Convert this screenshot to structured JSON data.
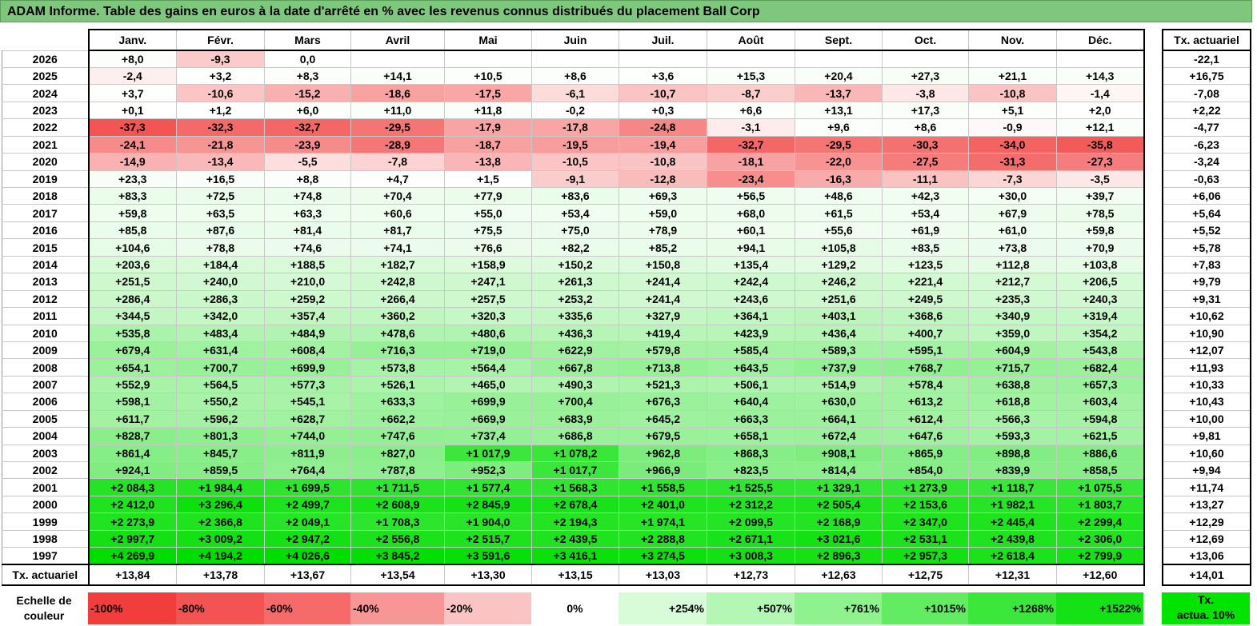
{
  "title": "ADAM Informe. Table des gains en euros à la date d'arrêté en % avec les revenus connus distribués du placement Ball Corp",
  "months": [
    "Janv.",
    "Févr.",
    "Mars",
    "Avril",
    "Mai",
    "Juin",
    "Juil.",
    "Août",
    "Sept.",
    "Oct.",
    "Nov.",
    "Déc."
  ],
  "side_header": "Tx. actuariel",
  "rows": [
    {
      "year": "2026",
      "values": [
        "+8,0",
        "-9,3",
        "0,0",
        "",
        "",
        "",
        "",
        "",
        "",
        "",
        "",
        ""
      ],
      "tx": "-22,1"
    },
    {
      "year": "2025",
      "values": [
        "-2,4",
        "+3,2",
        "+8,3",
        "+14,1",
        "+10,5",
        "+8,6",
        "+3,6",
        "+15,3",
        "+20,4",
        "+27,3",
        "+21,1",
        "+14,3"
      ],
      "tx": "+16,75"
    },
    {
      "year": "2024",
      "values": [
        "+3,7",
        "-10,6",
        "-15,2",
        "-18,6",
        "-17,5",
        "-6,1",
        "-10,7",
        "-8,7",
        "-13,7",
        "-3,8",
        "-10,8",
        "-1,4"
      ],
      "tx": "-7,08"
    },
    {
      "year": "2023",
      "values": [
        "+0,1",
        "+1,2",
        "+6,0",
        "+11,0",
        "+11,8",
        "-0,2",
        "+0,3",
        "+6,6",
        "+13,1",
        "+17,3",
        "+5,1",
        "+2,0"
      ],
      "tx": "+2,22"
    },
    {
      "year": "2022",
      "values": [
        "-37,3",
        "-32,3",
        "-32,7",
        "-29,5",
        "-17,9",
        "-17,8",
        "-24,8",
        "-3,1",
        "+9,6",
        "+8,6",
        "-0,9",
        "+12,1"
      ],
      "tx": "-4,77"
    },
    {
      "year": "2021",
      "values": [
        "-24,1",
        "-21,8",
        "-23,9",
        "-28,9",
        "-18,7",
        "-19,5",
        "-19,4",
        "-32,7",
        "-29,5",
        "-30,3",
        "-34,0",
        "-35,8"
      ],
      "tx": "-6,23"
    },
    {
      "year": "2020",
      "values": [
        "-14,9",
        "-13,4",
        "-5,5",
        "-7,8",
        "-13,8",
        "-10,5",
        "-10,8",
        "-18,1",
        "-22,0",
        "-27,5",
        "-31,3",
        "-27,3"
      ],
      "tx": "-3,24"
    },
    {
      "year": "2019",
      "values": [
        "+23,3",
        "+16,5",
        "+8,8",
        "+4,7",
        "+1,5",
        "-9,1",
        "-12,8",
        "-23,4",
        "-16,3",
        "-11,1",
        "-7,3",
        "-3,5"
      ],
      "tx": "-0,63"
    },
    {
      "year": "2018",
      "values": [
        "+83,3",
        "+72,5",
        "+74,8",
        "+70,4",
        "+77,9",
        "+83,6",
        "+69,3",
        "+56,5",
        "+48,6",
        "+42,3",
        "+30,0",
        "+39,7"
      ],
      "tx": "+6,06"
    },
    {
      "year": "2017",
      "values": [
        "+59,8",
        "+63,5",
        "+63,3",
        "+60,6",
        "+55,0",
        "+53,4",
        "+59,0",
        "+68,0",
        "+61,5",
        "+53,4",
        "+67,9",
        "+78,5"
      ],
      "tx": "+5,64"
    },
    {
      "year": "2016",
      "values": [
        "+85,8",
        "+87,6",
        "+81,4",
        "+81,7",
        "+75,5",
        "+75,0",
        "+78,9",
        "+60,1",
        "+55,6",
        "+61,9",
        "+61,0",
        "+59,8"
      ],
      "tx": "+5,52"
    },
    {
      "year": "2015",
      "values": [
        "+104,6",
        "+78,8",
        "+74,6",
        "+74,1",
        "+76,6",
        "+82,2",
        "+85,2",
        "+94,1",
        "+105,8",
        "+83,5",
        "+73,8",
        "+70,9"
      ],
      "tx": "+5,78"
    },
    {
      "year": "2014",
      "values": [
        "+203,6",
        "+184,4",
        "+188,5",
        "+182,7",
        "+158,9",
        "+150,2",
        "+150,8",
        "+135,4",
        "+129,2",
        "+123,5",
        "+112,8",
        "+103,8"
      ],
      "tx": "+7,83"
    },
    {
      "year": "2013",
      "values": [
        "+251,5",
        "+240,0",
        "+210,0",
        "+242,8",
        "+247,1",
        "+261,3",
        "+241,4",
        "+242,4",
        "+246,2",
        "+221,4",
        "+212,7",
        "+206,5"
      ],
      "tx": "+9,79"
    },
    {
      "year": "2012",
      "values": [
        "+286,4",
        "+286,3",
        "+259,2",
        "+266,4",
        "+257,5",
        "+253,2",
        "+241,4",
        "+243,6",
        "+251,6",
        "+249,5",
        "+235,3",
        "+240,3"
      ],
      "tx": "+9,31"
    },
    {
      "year": "2011",
      "values": [
        "+344,5",
        "+342,0",
        "+357,4",
        "+360,2",
        "+320,3",
        "+335,6",
        "+327,9",
        "+364,1",
        "+403,1",
        "+368,6",
        "+340,9",
        "+319,4"
      ],
      "tx": "+10,62"
    },
    {
      "year": "2010",
      "values": [
        "+535,8",
        "+483,4",
        "+484,9",
        "+478,6",
        "+480,6",
        "+436,3",
        "+419,4",
        "+423,9",
        "+436,4",
        "+400,7",
        "+359,0",
        "+354,2"
      ],
      "tx": "+10,90"
    },
    {
      "year": "2009",
      "values": [
        "+679,4",
        "+631,4",
        "+608,4",
        "+716,3",
        "+719,0",
        "+622,9",
        "+579,8",
        "+585,4",
        "+589,3",
        "+595,1",
        "+604,9",
        "+543,8"
      ],
      "tx": "+12,07"
    },
    {
      "year": "2008",
      "values": [
        "+654,1",
        "+700,7",
        "+699,9",
        "+573,8",
        "+564,4",
        "+667,8",
        "+713,8",
        "+643,5",
        "+737,9",
        "+768,7",
        "+715,7",
        "+682,4"
      ],
      "tx": "+11,93"
    },
    {
      "year": "2007",
      "values": [
        "+552,9",
        "+564,5",
        "+577,3",
        "+526,1",
        "+465,0",
        "+490,3",
        "+521,3",
        "+506,1",
        "+514,9",
        "+578,4",
        "+638,8",
        "+657,3"
      ],
      "tx": "+10,33"
    },
    {
      "year": "2006",
      "values": [
        "+598,1",
        "+550,2",
        "+545,1",
        "+633,3",
        "+699,9",
        "+700,4",
        "+676,3",
        "+640,4",
        "+630,0",
        "+613,2",
        "+618,8",
        "+603,4"
      ],
      "tx": "+10,43"
    },
    {
      "year": "2005",
      "values": [
        "+611,7",
        "+596,2",
        "+628,7",
        "+662,2",
        "+669,9",
        "+683,9",
        "+645,2",
        "+663,3",
        "+664,1",
        "+612,4",
        "+566,3",
        "+594,8"
      ],
      "tx": "+10,00"
    },
    {
      "year": "2004",
      "values": [
        "+828,7",
        "+801,3",
        "+744,0",
        "+747,6",
        "+737,4",
        "+686,8",
        "+679,5",
        "+658,1",
        "+672,4",
        "+647,6",
        "+593,3",
        "+621,5"
      ],
      "tx": "+9,81"
    },
    {
      "year": "2003",
      "values": [
        "+861,4",
        "+845,7",
        "+811,9",
        "+827,0",
        "+1 017,9",
        "+1 078,2",
        "+962,8",
        "+868,3",
        "+908,1",
        "+865,9",
        "+898,8",
        "+886,6"
      ],
      "tx": "+10,60"
    },
    {
      "year": "2002",
      "values": [
        "+924,1",
        "+859,5",
        "+764,4",
        "+787,8",
        "+952,3",
        "+1 017,7",
        "+966,9",
        "+823,5",
        "+814,4",
        "+854,0",
        "+839,9",
        "+858,5"
      ],
      "tx": "+9,94"
    },
    {
      "year": "2001",
      "values": [
        "+2 084,3",
        "+1 984,4",
        "+1 699,5",
        "+1 711,5",
        "+1 577,4",
        "+1 568,3",
        "+1 558,5",
        "+1 525,5",
        "+1 329,1",
        "+1 273,9",
        "+1 118,7",
        "+1 075,5"
      ],
      "tx": "+11,74"
    },
    {
      "year": "2000",
      "values": [
        "+2 412,0",
        "+3 296,4",
        "+2 499,7",
        "+2 608,9",
        "+2 845,9",
        "+2 678,4",
        "+2 401,0",
        "+2 312,2",
        "+2 505,4",
        "+2 153,6",
        "+1 982,1",
        "+1 803,7"
      ],
      "tx": "+13,27"
    },
    {
      "year": "1999",
      "values": [
        "+2 273,9",
        "+2 366,8",
        "+2 049,1",
        "+1 708,3",
        "+1 904,0",
        "+2 194,3",
        "+1 974,1",
        "+2 099,5",
        "+2 168,9",
        "+2 347,0",
        "+2 445,4",
        "+2 299,4"
      ],
      "tx": "+12,29"
    },
    {
      "year": "1998",
      "values": [
        "+2 997,7",
        "+3 009,2",
        "+2 947,2",
        "+2 556,8",
        "+2 515,7",
        "+2 439,5",
        "+2 288,8",
        "+2 671,1",
        "+3 021,6",
        "+2 531,1",
        "+2 439,8",
        "+2 306,0"
      ],
      "tx": "+12,69"
    },
    {
      "year": "1997",
      "values": [
        "+4 269,9",
        "+4 194,2",
        "+4 026,6",
        "+3 845,2",
        "+3 591,6",
        "+3 416,1",
        "+3 274,5",
        "+3 008,3",
        "+2 896,3",
        "+2 957,3",
        "+2 618,4",
        "+2 799,9"
      ],
      "tx": "+13,06"
    }
  ],
  "footer": {
    "label": "Tx. actuariel",
    "values": [
      "+13,84",
      "+13,78",
      "+13,67",
      "+13,54",
      "+13,30",
      "+13,15",
      "+13,03",
      "+12,73",
      "+12,63",
      "+12,75",
      "+12,31",
      "+12,60"
    ],
    "tx": "+14,01"
  },
  "scale": {
    "label_line1": "Echelle de",
    "label_line2": "couleur",
    "items": [
      {
        "text": "-100%",
        "color": "#f23d3d",
        "align": "left"
      },
      {
        "text": "-80%",
        "color": "#f45353",
        "align": "left"
      },
      {
        "text": "-60%",
        "color": "#f66a6a",
        "align": "left"
      },
      {
        "text": "-40%",
        "color": "#f89595",
        "align": "left"
      },
      {
        "text": "-20%",
        "color": "#fbc4c4",
        "align": "left"
      },
      {
        "text": "0%",
        "color": "#ffffff",
        "align": "center"
      },
      {
        "text": "+254%",
        "color": "#d8fbd8",
        "align": "right"
      },
      {
        "text": "+507%",
        "color": "#b4f7b4",
        "align": "right"
      },
      {
        "text": "+761%",
        "color": "#8ef28e",
        "align": "right"
      },
      {
        "text": "+1015%",
        "color": "#62ec62",
        "align": "right"
      },
      {
        "text": "+1268%",
        "color": "#3ae73a",
        "align": "right"
      },
      {
        "text": "+1522%",
        "color": "#14e214",
        "align": "right"
      }
    ],
    "tx_line1": "Tx.",
    "tx_line2": "actua. 10%"
  }
}
